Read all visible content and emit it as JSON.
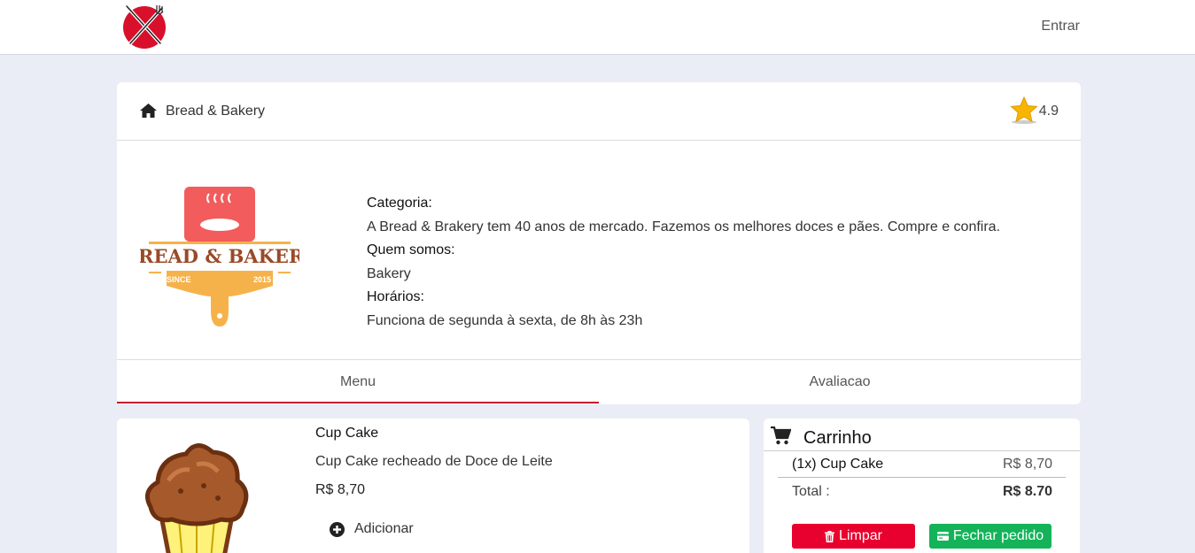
{
  "header": {
    "login_label": "Entrar"
  },
  "store": {
    "name": "Bread & Bakery",
    "rating": "4.9",
    "logo_text": "BREAD & BAKERY",
    "logo_since": "SINCE",
    "logo_year": "2015",
    "info": {
      "category_label": "Categoria:",
      "category_value": "A Bread & Brakery tem 40 anos de mercado. Fazemos os melhores doces e pães. Compre e confira.",
      "about_label": "Quem somos:",
      "about_value": "Bakery",
      "hours_label": "Horários:",
      "hours_value": "Funciona de segunda à sexta, de 8h às 23h"
    }
  },
  "tabs": [
    {
      "label": "Menu",
      "active": true
    },
    {
      "label": "Avaliacao",
      "active": false
    }
  ],
  "product": {
    "name": "Cup Cake",
    "description": "Cup Cake recheado de Doce de Leite",
    "price": "R$ 8,70",
    "add_label": "Adicionar"
  },
  "cart": {
    "title": "Carrinho",
    "items": [
      {
        "label": "(1x) Cup Cake",
        "price": "R$ 8,70"
      }
    ],
    "total_label": "Total :",
    "total_value": "R$ 8.70",
    "clear_label": "Limpar",
    "checkout_label": "Fechar pedido"
  },
  "colors": {
    "accent": "#c8102e",
    "danger": "#e8002e",
    "success": "#14b35a",
    "background": "#eaedf5"
  }
}
